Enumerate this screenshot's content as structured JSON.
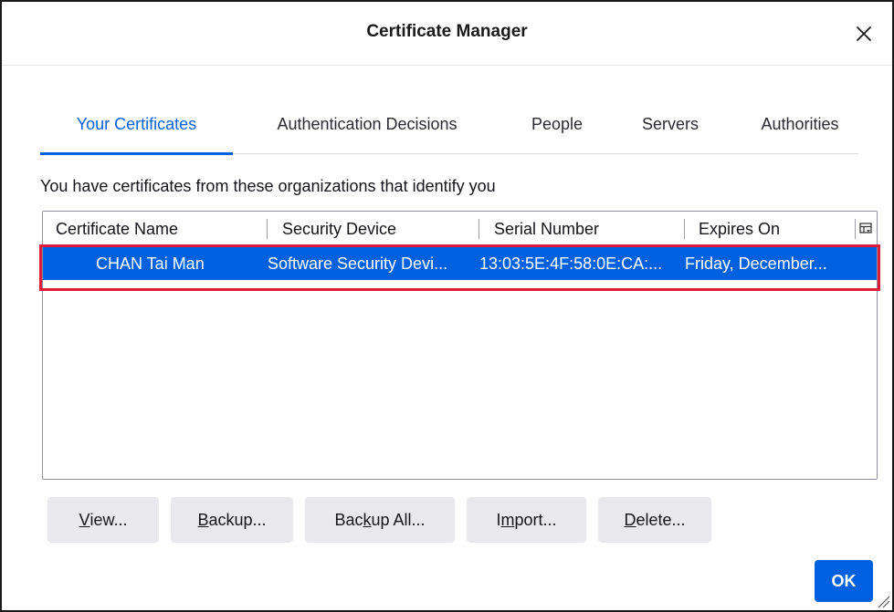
{
  "dialog": {
    "title": "Certificate Manager"
  },
  "tabs": [
    {
      "label": "Your Certificates",
      "selected": true
    },
    {
      "label": "Authentication Decisions",
      "selected": false
    },
    {
      "label": "People",
      "selected": false
    },
    {
      "label": "Servers",
      "selected": false
    },
    {
      "label": "Authorities",
      "selected": false
    }
  ],
  "intro_text": "You have certificates from these organizations that identify you",
  "table": {
    "columns": [
      "Certificate Name",
      "Security Device",
      "Serial Number",
      "Expires On"
    ],
    "rows": [
      {
        "name": "CHAN Tai Man",
        "device": "Software Security Devi...",
        "serial": "13:03:5E:4F:58:0E:CA:...",
        "expires": "Friday, December..."
      }
    ]
  },
  "buttons": {
    "view": {
      "pre": "",
      "key": "V",
      "post": "iew..."
    },
    "backup": {
      "pre": "",
      "key": "B",
      "post": "ackup..."
    },
    "backup_all": {
      "pre": "Bac",
      "key": "k",
      "post": "up All..."
    },
    "import": {
      "pre": "I",
      "key": "m",
      "post": "port..."
    },
    "delete": {
      "pre": "",
      "key": "D",
      "post": "elete..."
    },
    "ok": "OK"
  },
  "colors": {
    "accent": "#0061e0",
    "highlight_outline": "#e01b3a",
    "button_bg": "#e9e9ed"
  },
  "icons": {
    "close": "close-icon",
    "column_picker": "column-picker-icon",
    "resize": "resize-grip-icon"
  }
}
